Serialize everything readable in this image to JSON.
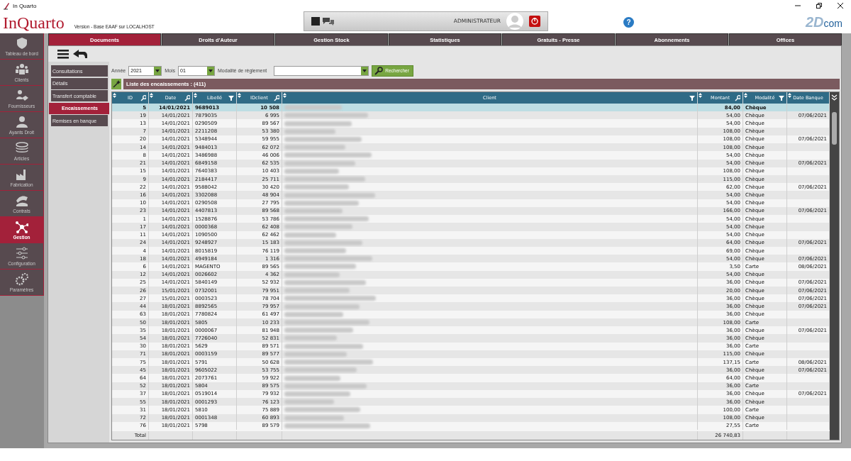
{
  "window": {
    "title": "In Quarto"
  },
  "header": {
    "logo": "InQuarto",
    "version": "Version  - Base EAAF sur LOCALHOST",
    "user": "ADMINISTRATEUR",
    "help": "?",
    "brand": [
      "2D",
      "com"
    ]
  },
  "tabs": [
    {
      "label": "Documents",
      "selected": true
    },
    {
      "label": "Droits d'Auteur",
      "selected": false
    },
    {
      "label": "Gestion Stock",
      "selected": false
    },
    {
      "label": "Statistiques",
      "selected": false
    },
    {
      "label": "Gratuits - Presse",
      "selected": false
    },
    {
      "label": "Abonnements",
      "selected": false
    },
    {
      "label": "Offices",
      "selected": false
    }
  ],
  "sidebar": {
    "items": [
      {
        "label": "Tableau de bord",
        "selected": false
      },
      {
        "label": "Clients",
        "selected": false
      },
      {
        "label": "Fournisseurs",
        "selected": false
      },
      {
        "label": "Ayants Droit",
        "selected": false
      },
      {
        "label": "Articles",
        "selected": false
      },
      {
        "label": "Fabrication",
        "selected": false
      },
      {
        "label": "Contrats",
        "selected": false
      },
      {
        "label": "Gestion",
        "selected": true
      },
      {
        "label": "Configuration",
        "selected": false
      },
      {
        "label": "Paramètres",
        "selected": false
      }
    ]
  },
  "submenu": [
    {
      "label": "Consultations",
      "selected": false
    },
    {
      "label": "Détails",
      "selected": false
    },
    {
      "label": "Transfert comptable",
      "selected": false
    },
    {
      "label": "Encaissements",
      "selected": true
    },
    {
      "label": "Remises en banque",
      "selected": false
    }
  ],
  "filters": {
    "year_label": "Année",
    "year": "2021",
    "month_label": "Mois",
    "month": "01",
    "mode_label": "Modalité de règlement",
    "search_button": "Rechercher"
  },
  "list_title": "Liste des encaissements : (411)",
  "table": {
    "columns": [
      {
        "label": "ID",
        "kind": "text",
        "searchable": true,
        "filterable": false
      },
      {
        "label": "Date",
        "kind": "text",
        "searchable": true,
        "filterable": false
      },
      {
        "label": "Libellé",
        "kind": "text",
        "searchable": false,
        "filterable": true
      },
      {
        "label": "IDclient",
        "kind": "text",
        "searchable": true,
        "filterable": false
      },
      {
        "label": "Client",
        "kind": "blurred",
        "searchable": false,
        "filterable": true
      },
      {
        "label": "Montant",
        "kind": "text",
        "searchable": true,
        "filterable": false
      },
      {
        "label": "Modalité",
        "kind": "text",
        "searchable": false,
        "filterable": true
      },
      {
        "label": "Date Banque",
        "kind": "text",
        "searchable": false,
        "filterable": false
      }
    ],
    "rows": [
      {
        "selected": true,
        "cells": [
          "5",
          "14/01/2021",
          "9689013",
          "10 508",
          "84,00",
          "Chèque",
          null
        ]
      },
      {
        "selected": false,
        "cells": [
          "19",
          "14/01/2021",
          "7879035",
          "6 995",
          "54,00",
          "Chèque",
          "07/06/2021"
        ]
      },
      {
        "selected": false,
        "cells": [
          "13",
          "14/01/2021",
          "0290509",
          "89 567",
          "54,00",
          "Chèque",
          null
        ]
      },
      {
        "selected": false,
        "cells": [
          "7",
          "14/01/2021",
          "2211208",
          "53 380",
          "108,00",
          "Chèque",
          null
        ]
      },
      {
        "selected": false,
        "cells": [
          "20",
          "14/01/2021",
          "5348944",
          "59 955",
          "108,00",
          "Chèque",
          "07/06/2021"
        ]
      },
      {
        "selected": false,
        "cells": [
          "14",
          "14/01/2021",
          "9484013",
          "62 072",
          "108,00",
          "Chèque",
          null
        ]
      },
      {
        "selected": false,
        "cells": [
          "8",
          "14/01/2021",
          "3486988",
          "46 006",
          "54,00",
          "Chèque",
          null
        ]
      },
      {
        "selected": false,
        "cells": [
          "21",
          "14/01/2021",
          "6849158",
          "62 535",
          "54,00",
          "Chèque",
          "07/06/2021"
        ]
      },
      {
        "selected": false,
        "cells": [
          "15",
          "14/01/2021",
          "7640383",
          "10 403",
          "108,00",
          "Chèque",
          null
        ]
      },
      {
        "selected": false,
        "cells": [
          "9",
          "14/01/2021",
          "2184417",
          "25 711",
          "115,00",
          "Chèque",
          null
        ]
      },
      {
        "selected": false,
        "cells": [
          "22",
          "14/01/2021",
          "9588042",
          "30 420",
          "62,00",
          "Chèque",
          "07/06/2021"
        ]
      },
      {
        "selected": false,
        "cells": [
          "16",
          "14/01/2021",
          "3302088",
          "48 904",
          "54,00",
          "Chèque",
          null
        ]
      },
      {
        "selected": false,
        "cells": [
          "10",
          "14/01/2021",
          "0290508",
          "27 795",
          "54,00",
          "Chèque",
          null
        ]
      },
      {
        "selected": false,
        "cells": [
          "23",
          "14/01/2021",
          "4407813",
          "89 568",
          "166,00",
          "Chèque",
          "07/06/2021"
        ]
      },
      {
        "selected": false,
        "cells": [
          "1",
          "14/01/2021",
          "1528876",
          "53 786",
          "54,00",
          "Chèque",
          null
        ]
      },
      {
        "selected": false,
        "cells": [
          "17",
          "14/01/2021",
          "0000368",
          "62 408",
          "54,00",
          "Chèque",
          null
        ]
      },
      {
        "selected": false,
        "cells": [
          "11",
          "14/01/2021",
          "1090500",
          "62 462",
          "54,00",
          "Chèque",
          null
        ]
      },
      {
        "selected": false,
        "cells": [
          "24",
          "14/01/2021",
          "9248927",
          "15 183",
          "64,00",
          "Chèque",
          "07/06/2021"
        ]
      },
      {
        "selected": false,
        "cells": [
          "4",
          "14/01/2021",
          "8015819",
          "76 119",
          "69,00",
          "Chèque",
          null
        ]
      },
      {
        "selected": false,
        "cells": [
          "18",
          "14/01/2021",
          "4949184",
          "1 316",
          "54,00",
          "Chèque",
          "07/06/2021"
        ]
      },
      {
        "selected": false,
        "cells": [
          "6",
          "14/01/2021",
          "MAGENTO",
          "89 565",
          "3,50",
          "Carte",
          "08/06/2021"
        ]
      },
      {
        "selected": false,
        "cells": [
          "12",
          "14/01/2021",
          "0026602",
          "4 362",
          "54,00",
          "Chèque",
          null
        ]
      },
      {
        "selected": false,
        "cells": [
          "25",
          "14/01/2021",
          "5840149",
          "52 932",
          "36,00",
          "Chèque",
          "07/06/2021"
        ]
      },
      {
        "selected": false,
        "cells": [
          "26",
          "15/01/2021",
          "0732001",
          "79 951",
          "20,00",
          "Chèque",
          "07/06/2021"
        ]
      },
      {
        "selected": false,
        "cells": [
          "27",
          "15/01/2021",
          "0003523",
          "78 704",
          "36,00",
          "Chèque",
          "07/06/2021"
        ]
      },
      {
        "selected": false,
        "cells": [
          "44",
          "18/01/2021",
          "8892565",
          "79 957",
          "36,00",
          "Chèque",
          "07/06/2021"
        ]
      },
      {
        "selected": false,
        "cells": [
          "63",
          "18/01/2021",
          "7780824",
          "61 497",
          "36,00",
          "Chèque",
          null
        ]
      },
      {
        "selected": false,
        "cells": [
          "50",
          "18/01/2021",
          "5805",
          "10 233",
          "108,00",
          "Carte",
          null
        ]
      },
      {
        "selected": false,
        "cells": [
          "35",
          "18/01/2021",
          "0000067",
          "81 948",
          "36,00",
          "Chèque",
          "07/06/2021"
        ]
      },
      {
        "selected": false,
        "cells": [
          "54",
          "18/01/2021",
          "7726040",
          "52 831",
          "36,00",
          "Chèque",
          null
        ]
      },
      {
        "selected": false,
        "cells": [
          "30",
          "18/01/2021",
          "5629",
          "89 571",
          "36,00",
          "Carte",
          null
        ]
      },
      {
        "selected": false,
        "cells": [
          "71",
          "18/01/2021",
          "0003159",
          "89 577",
          "115,00",
          "Chèque",
          null
        ]
      },
      {
        "selected": false,
        "cells": [
          "75",
          "18/01/2021",
          "5791",
          "50 628",
          "137,15",
          "Carte",
          "08/06/2021"
        ]
      },
      {
        "selected": false,
        "cells": [
          "45",
          "18/01/2021",
          "9605022",
          "53 755",
          "36,00",
          "Chèque",
          "07/06/2021"
        ]
      },
      {
        "selected": false,
        "cells": [
          "64",
          "18/01/2021",
          "2073761",
          "59 922",
          "64,00",
          "Chèque",
          null
        ]
      },
      {
        "selected": false,
        "cells": [
          "52",
          "18/01/2021",
          "5804",
          "89 575",
          "36,00",
          "Carte",
          null
        ]
      },
      {
        "selected": false,
        "cells": [
          "37",
          "18/01/2021",
          "0519014",
          "79 932",
          "36,00",
          "Chèque",
          "07/06/2021"
        ]
      },
      {
        "selected": false,
        "cells": [
          "55",
          "18/01/2021",
          "0001293",
          "76 123",
          "36,00",
          "Chèque",
          null
        ]
      },
      {
        "selected": false,
        "cells": [
          "31",
          "18/01/2021",
          "5810",
          "75 889",
          "100,00",
          "Carte",
          null
        ]
      },
      {
        "selected": false,
        "cells": [
          "72",
          "18/01/2021",
          "0001348",
          "60 893",
          "108,00",
          "Chèque",
          null
        ]
      },
      {
        "selected": false,
        "cells": [
          "76",
          "18/01/2021",
          "5798",
          "89 579",
          "27,55",
          "Carte",
          null
        ]
      }
    ],
    "total_label": "Total",
    "total_amount": "26 740,83"
  }
}
